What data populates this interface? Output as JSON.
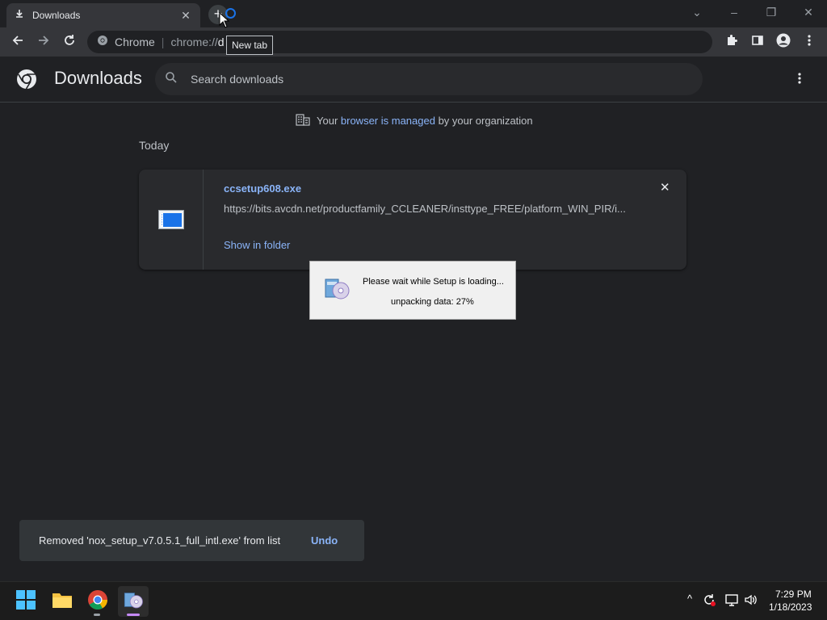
{
  "tab": {
    "title": "Downloads",
    "close": "✕",
    "new_tab": "+"
  },
  "tooltip": "New tab",
  "window_controls": {
    "chevron": "⌄",
    "minimize": "–",
    "restore": "❐",
    "close": "✕"
  },
  "omnibox": {
    "site_label": "Chrome",
    "separator": "|",
    "url_prefix": "chrome://",
    "url_rest": "d"
  },
  "page": {
    "title": "Downloads",
    "search_placeholder": "Search downloads",
    "managed_prefix": "Your ",
    "managed_link": "browser is managed",
    "managed_suffix": " by your organization",
    "section": "Today"
  },
  "download": {
    "file_name": "ccsetup608.exe",
    "url": "https://bits.avcdn.net/productfamily_CCLEANER/insttype_FREE/platform_WIN_PIR/i...",
    "action": "Show in folder",
    "close": "✕"
  },
  "setup_dialog": {
    "message": "Please wait while Setup is loading...",
    "progress_text": "unpacking data: 27%"
  },
  "toast": {
    "message": "Removed 'nox_setup_v7.0.5.1_full_intl.exe' from list",
    "undo": "Undo"
  },
  "taskbar": {
    "time": "7:29 PM",
    "date": "1/18/2023",
    "tray_chevron": "^"
  },
  "colors": {
    "accent_link": "#8ab4f8",
    "background": "#202124",
    "card": "#292a2d",
    "toolbar": "#35363a"
  },
  "icons": [
    "download-icon",
    "spinner-icon",
    "back-arrow-icon",
    "forward-arrow-icon",
    "reload-icon",
    "chrome-icon",
    "share-icon",
    "star-icon",
    "extensions-icon",
    "side-panel-icon",
    "profile-icon",
    "more-menu-icon",
    "chrome-logo-icon",
    "search-icon",
    "building-icon",
    "file-icon",
    "setup-installer-icon",
    "windows-start-icon",
    "file-explorer-icon",
    "chrome-taskbar-icon",
    "installer-taskbar-icon",
    "tray-chevron-icon",
    "sync-icon",
    "network-icon",
    "volume-icon"
  ]
}
